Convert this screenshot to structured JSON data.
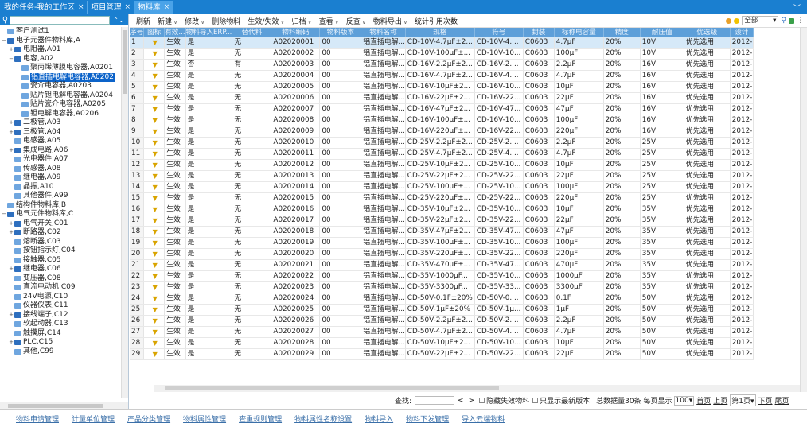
{
  "tabs": [
    {
      "label": "我的任务-我的工作区",
      "active": false
    },
    {
      "label": "项目管理",
      "active": false
    },
    {
      "label": "物料库",
      "active": true
    }
  ],
  "tree": [
    {
      "label": "客户测试1",
      "depth": 0,
      "tg": "",
      "light": true
    },
    {
      "label": "电子元器件物料库,A",
      "depth": 0,
      "tg": "⊟",
      "light": false
    },
    {
      "label": "电阻器,A01",
      "depth": 1,
      "tg": "⊞",
      "light": false
    },
    {
      "label": "电容,A02",
      "depth": 1,
      "tg": "⊟",
      "light": false
    },
    {
      "label": "聚丙烯薄膜电容器,A0201",
      "depth": 2,
      "tg": "",
      "light": true
    },
    {
      "label": "铝直插电解电容器,A0202",
      "depth": 2,
      "tg": "",
      "light": true,
      "sel": true
    },
    {
      "label": "瓷介电容器,A0203",
      "depth": 2,
      "tg": "",
      "light": true
    },
    {
      "label": "贴片钽电解电容器,A0204",
      "depth": 2,
      "tg": "",
      "light": true
    },
    {
      "label": "贴片瓷介电容器,A0205",
      "depth": 2,
      "tg": "",
      "light": true
    },
    {
      "label": "钽电解电容器,A0206",
      "depth": 2,
      "tg": "",
      "light": true
    },
    {
      "label": "二极管,A03",
      "depth": 1,
      "tg": "⊞",
      "light": false
    },
    {
      "label": "三极管,A04",
      "depth": 1,
      "tg": "⊞",
      "light": false
    },
    {
      "label": "电感器,A05",
      "depth": 1,
      "tg": "",
      "light": true
    },
    {
      "label": "集成电路,A06",
      "depth": 1,
      "tg": "⊞",
      "light": false
    },
    {
      "label": "光电器件,A07",
      "depth": 1,
      "tg": "",
      "light": true
    },
    {
      "label": "传感器,A08",
      "depth": 1,
      "tg": "",
      "light": true
    },
    {
      "label": "继电器,A09",
      "depth": 1,
      "tg": "",
      "light": true
    },
    {
      "label": "晶振,A10",
      "depth": 1,
      "tg": "",
      "light": true
    },
    {
      "label": "其他器件,A99",
      "depth": 1,
      "tg": "",
      "light": true
    },
    {
      "label": "结构件物料库,B",
      "depth": 0,
      "tg": "",
      "light": true
    },
    {
      "label": "电气元件物料库,C",
      "depth": 0,
      "tg": "⊟",
      "light": false
    },
    {
      "label": "电气开关,C01",
      "depth": 1,
      "tg": "⊞",
      "light": false
    },
    {
      "label": "断路器,C02",
      "depth": 1,
      "tg": "⊞",
      "light": false
    },
    {
      "label": "熔断器,C03",
      "depth": 1,
      "tg": "",
      "light": true
    },
    {
      "label": "按钮指示灯,C04",
      "depth": 1,
      "tg": "",
      "light": true
    },
    {
      "label": "接触器,C05",
      "depth": 1,
      "tg": "",
      "light": true
    },
    {
      "label": "继电器,C06",
      "depth": 1,
      "tg": "⊞",
      "light": false
    },
    {
      "label": "变压器,C08",
      "depth": 1,
      "tg": "",
      "light": true
    },
    {
      "label": "直流电动机,C09",
      "depth": 1,
      "tg": "",
      "light": true
    },
    {
      "label": "24V电源,C10",
      "depth": 1,
      "tg": "",
      "light": true
    },
    {
      "label": "仪器仪表,C11",
      "depth": 1,
      "tg": "",
      "light": true
    },
    {
      "label": "接线端子,C12",
      "depth": 1,
      "tg": "⊞",
      "light": false
    },
    {
      "label": "软起动器,C13",
      "depth": 1,
      "tg": "",
      "light": true
    },
    {
      "label": "触摸屏,C14",
      "depth": 1,
      "tg": "",
      "light": true
    },
    {
      "label": "PLC,C15",
      "depth": 1,
      "tg": "⊞",
      "light": false
    },
    {
      "label": "其他,C99",
      "depth": 1,
      "tg": "",
      "light": true
    }
  ],
  "toolbar": [
    {
      "label": "刷新",
      "dd": false
    },
    {
      "label": "新建",
      "dd": true
    },
    {
      "label": "修改",
      "dd": true
    },
    {
      "label": "删除物料",
      "dd": false
    },
    {
      "label": "生效/失效",
      "dd": true
    },
    {
      "label": "归档",
      "dd": true
    },
    {
      "label": "查看",
      "dd": true
    },
    {
      "label": "反查",
      "dd": true
    },
    {
      "label": "物料导出",
      "dd": true
    },
    {
      "label": "统计引用次数",
      "dd": false
    }
  ],
  "filter": {
    "value": "全部"
  },
  "columns": [
    "序号",
    "图标",
    "有效...",
    "物料导入ERP...",
    "替代料",
    "物料编码",
    "物料版本",
    "物料名称",
    "规格",
    "符号",
    "封装",
    "标称电容量",
    "精度",
    "耐压值",
    "优选级",
    "设计"
  ],
  "rows": [
    [
      "1",
      "生效",
      "是",
      "无",
      "A02020001",
      "00",
      "铝直插电解...",
      "CD-10V-4.7μF±2...",
      "CD-10V-4....",
      "C0603",
      "4.7μF",
      "20%",
      "10V",
      "优先选用",
      "2012-"
    ],
    [
      "2",
      "生效",
      "是",
      "无",
      "A02020002",
      "00",
      "铝直插电解...",
      "CD-10V-100μF±...",
      "CD-10V-10...",
      "C0603",
      "100μF",
      "20%",
      "10V",
      "优先选用",
      "2012-"
    ],
    [
      "3",
      "生效",
      "否",
      "有",
      "A02020003",
      "00",
      "铝直插电解...",
      "CD-16V-2.2μF±2...",
      "CD-16V-2....",
      "C0603",
      "2.2μF",
      "20%",
      "16V",
      "优先选用",
      "2012-"
    ],
    [
      "4",
      "生效",
      "是",
      "无",
      "A02020004",
      "00",
      "铝直插电解...",
      "CD-16V-4.7μF±2...",
      "CD-16V-4....",
      "C0603",
      "4.7μF",
      "20%",
      "16V",
      "优先选用",
      "2012-"
    ],
    [
      "5",
      "生效",
      "是",
      "无",
      "A02020005",
      "00",
      "铝直插电解...",
      "CD-16V-10μF±2...",
      "CD-16V-10...",
      "C0603",
      "10μF",
      "20%",
      "16V",
      "优先选用",
      "2012-"
    ],
    [
      "6",
      "生效",
      "是",
      "无",
      "A02020006",
      "00",
      "铝直插电解...",
      "CD-16V-22μF±2...",
      "CD-16V-22...",
      "C0603",
      "22μF",
      "20%",
      "16V",
      "优先选用",
      "2012-"
    ],
    [
      "7",
      "生效",
      "是",
      "无",
      "A02020007",
      "00",
      "铝直插电解...",
      "CD-16V-47μF±2...",
      "CD-16V-47...",
      "C0603",
      "47μF",
      "20%",
      "16V",
      "优先选用",
      "2012-"
    ],
    [
      "8",
      "生效",
      "是",
      "无",
      "A02020008",
      "00",
      "铝直插电解...",
      "CD-16V-100μF±...",
      "CD-16V-10...",
      "C0603",
      "100μF",
      "20%",
      "16V",
      "优先选用",
      "2012-"
    ],
    [
      "9",
      "生效",
      "是",
      "无",
      "A02020009",
      "00",
      "铝直插电解...",
      "CD-16V-220μF±...",
      "CD-16V-22...",
      "C0603",
      "220μF",
      "20%",
      "16V",
      "优先选用",
      "2012-"
    ],
    [
      "10",
      "生效",
      "是",
      "无",
      "A02020010",
      "00",
      "铝直插电解...",
      "CD-25V-2.2μF±2...",
      "CD-25V-2....",
      "C0603",
      "2.2μF",
      "20%",
      "25V",
      "优先选用",
      "2012-"
    ],
    [
      "11",
      "生效",
      "是",
      "无",
      "A02020011",
      "00",
      "铝直插电解...",
      "CD-25V-4.7μF±2...",
      "CD-25V-4....",
      "C0603",
      "4.7μF",
      "20%",
      "25V",
      "优先选用",
      "2012-"
    ],
    [
      "12",
      "生效",
      "是",
      "无",
      "A02020012",
      "00",
      "铝直插电解...",
      "CD-25V-10μF±2...",
      "CD-25V-10...",
      "C0603",
      "10μF",
      "20%",
      "25V",
      "优先选用",
      "2012-"
    ],
    [
      "13",
      "生效",
      "是",
      "无",
      "A02020013",
      "00",
      "铝直插电解...",
      "CD-25V-22μF±2...",
      "CD-25V-22...",
      "C0603",
      "22μF",
      "20%",
      "25V",
      "优先选用",
      "2012-"
    ],
    [
      "14",
      "生效",
      "是",
      "无",
      "A02020014",
      "00",
      "铝直插电解...",
      "CD-25V-100μF±...",
      "CD-25V-10...",
      "C0603",
      "100μF",
      "20%",
      "25V",
      "优先选用",
      "2012-"
    ],
    [
      "15",
      "生效",
      "是",
      "无",
      "A02020015",
      "00",
      "铝直插电解...",
      "CD-25V-220μF±...",
      "CD-25V-22...",
      "C0603",
      "220μF",
      "20%",
      "25V",
      "优先选用",
      "2012-"
    ],
    [
      "16",
      "生效",
      "是",
      "无",
      "A02020016",
      "00",
      "铝直插电解...",
      "CD-35V-10μF±2...",
      "CD-35V-10...",
      "C0603",
      "10μF",
      "20%",
      "35V",
      "优先选用",
      "2012-"
    ],
    [
      "17",
      "生效",
      "是",
      "无",
      "A02020017",
      "00",
      "铝直插电解...",
      "CD-35V-22μF±2...",
      "CD-35V-22...",
      "C0603",
      "22μF",
      "20%",
      "35V",
      "优先选用",
      "2012-"
    ],
    [
      "18",
      "生效",
      "是",
      "无",
      "A02020018",
      "00",
      "铝直插电解...",
      "CD-35V-47μF±2...",
      "CD-35V-47...",
      "C0603",
      "47μF",
      "20%",
      "35V",
      "优先选用",
      "2012-"
    ],
    [
      "19",
      "生效",
      "是",
      "无",
      "A02020019",
      "00",
      "铝直插电解...",
      "CD-35V-100μF±...",
      "CD-35V-10...",
      "C0603",
      "100μF",
      "20%",
      "35V",
      "优先选用",
      "2012-"
    ],
    [
      "20",
      "生效",
      "是",
      "无",
      "A02020020",
      "00",
      "铝直插电解...",
      "CD-35V-220μF±...",
      "CD-35V-22...",
      "C0603",
      "220μF",
      "20%",
      "35V",
      "优先选用",
      "2012-"
    ],
    [
      "21",
      "生效",
      "是",
      "无",
      "A02020021",
      "00",
      "铝直插电解...",
      "CD-35V-470μF±...",
      "CD-35V-47...",
      "C0603",
      "470μF",
      "20%",
      "35V",
      "优先选用",
      "2012-"
    ],
    [
      "22",
      "生效",
      "是",
      "无",
      "A02020022",
      "00",
      "铝直插电解...",
      "CD-35V-1000μF...",
      "CD-35V-10...",
      "C0603",
      "1000μF",
      "20%",
      "35V",
      "优先选用",
      "2012-"
    ],
    [
      "23",
      "生效",
      "是",
      "无",
      "A02020023",
      "00",
      "铝直插电解...",
      "CD-35V-3300μF...",
      "CD-35V-33...",
      "C0603",
      "3300μF",
      "20%",
      "35V",
      "优先选用",
      "2012-"
    ],
    [
      "24",
      "生效",
      "是",
      "无",
      "A02020024",
      "00",
      "铝直插电解...",
      "CD-50V-0.1F±20%",
      "CD-50V-0....",
      "C0603",
      "0.1F",
      "20%",
      "50V",
      "优先选用",
      "2012-"
    ],
    [
      "25",
      "生效",
      "是",
      "无",
      "A02020025",
      "00",
      "铝直插电解...",
      "CD-50V-1μF±20%",
      "CD-50V-1μ...",
      "C0603",
      "1μF",
      "20%",
      "50V",
      "优先选用",
      "2012-"
    ],
    [
      "26",
      "生效",
      "是",
      "无",
      "A02020026",
      "00",
      "铝直插电解...",
      "CD-50V-2.2μF±2...",
      "CD-50V-2....",
      "C0603",
      "2.2μF",
      "20%",
      "50V",
      "优先选用",
      "2012-"
    ],
    [
      "27",
      "生效",
      "是",
      "无",
      "A02020027",
      "00",
      "铝直插电解...",
      "CD-50V-4.7μF±2...",
      "CD-50V-4....",
      "C0603",
      "4.7μF",
      "20%",
      "50V",
      "优先选用",
      "2012-"
    ],
    [
      "28",
      "生效",
      "是",
      "无",
      "A02020028",
      "00",
      "铝直插电解...",
      "CD-50V-10μF±2...",
      "CD-50V-10...",
      "C0603",
      "10μF",
      "20%",
      "50V",
      "优先选用",
      "2012-"
    ],
    [
      "29",
      "生效",
      "是",
      "无",
      "A02020029",
      "00",
      "铝直插电解...",
      "CD-50V-22μF±2...",
      "CD-50V-22...",
      "C0603",
      "22μF",
      "20%",
      "50V",
      "优先选用",
      "2012-"
    ]
  ],
  "pager": {
    "find": "查找:",
    "nav_prev": "<",
    "nav_next": ">",
    "hide_invalid": "隐藏失效物料",
    "latest_only": "只显示最新版本",
    "summary": "总数据量30条 每页显示",
    "page_size": "100",
    "first": "首页",
    "prev": "上页",
    "current": "第1页",
    "next": "下页",
    "last": "尾页"
  },
  "bottom_links": [
    "物料申请管理",
    "计量单位管理",
    "产品分类管理",
    "物料属性管理",
    "查重规则管理",
    "物料属性名称设置",
    "物料导入",
    "物料下发管理",
    "导入云端物料"
  ],
  "colors": {
    "accent": "#1a7fd0",
    "header": "#5d9fd9"
  }
}
